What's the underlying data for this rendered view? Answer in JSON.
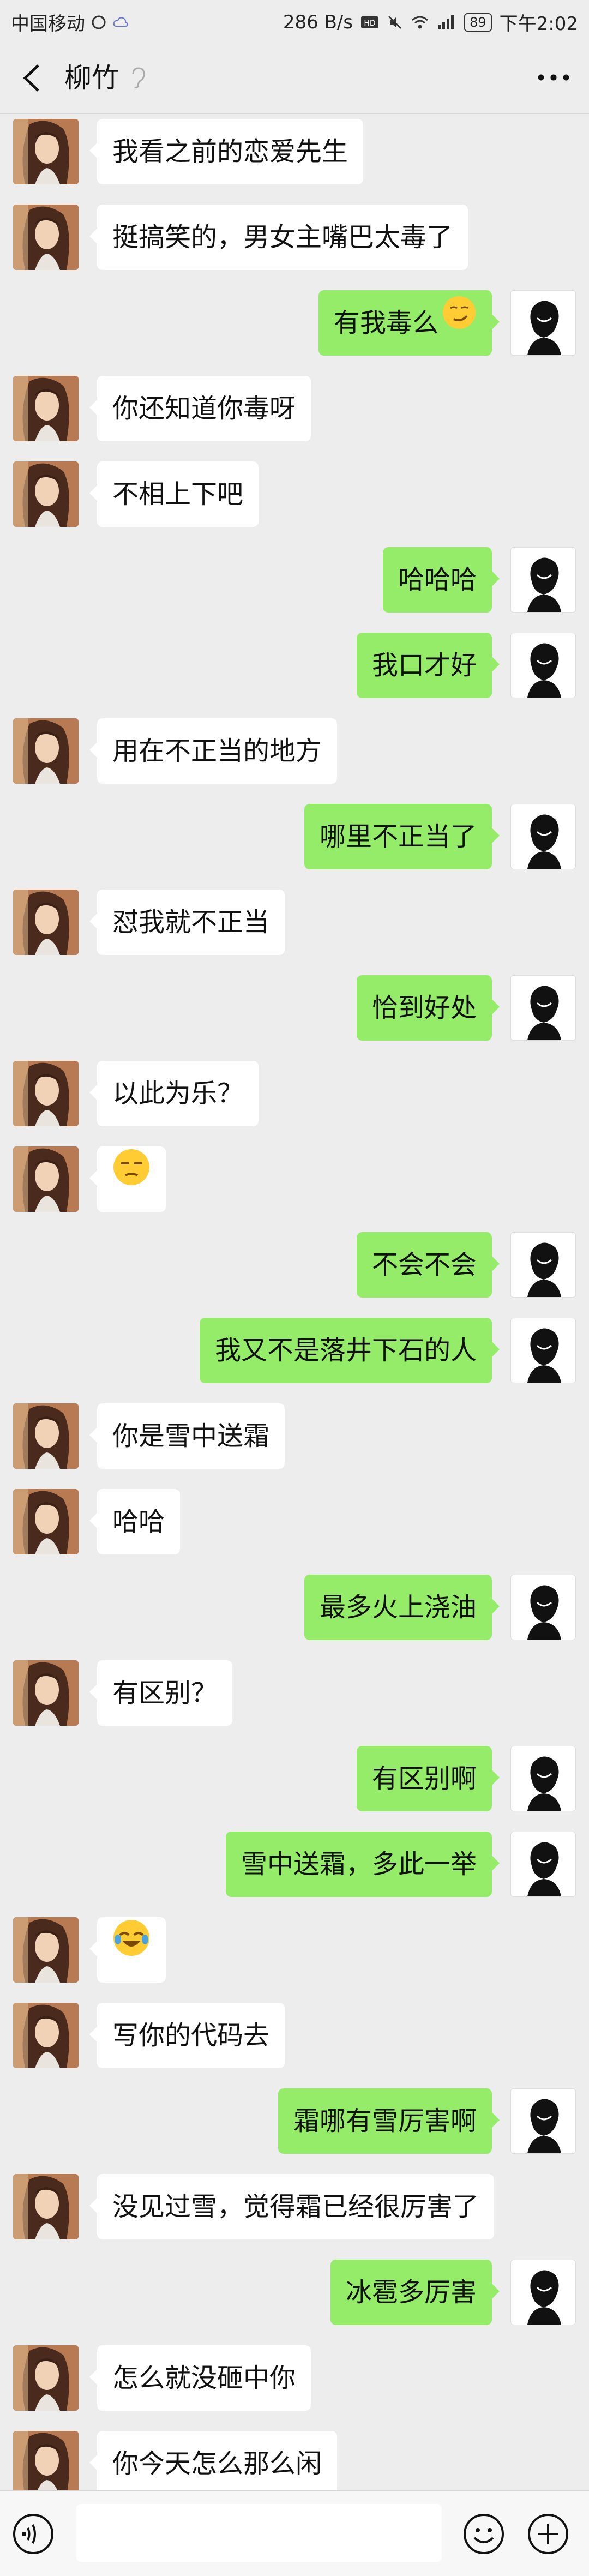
{
  "status_bar": {
    "carrier": "中国移动",
    "speed": "286 B/s",
    "battery": "89",
    "time": "下午2:02"
  },
  "header": {
    "contact_name": "柳竹"
  },
  "input": {
    "placeholder": ""
  },
  "messages": [
    {
      "from": "her",
      "text": "我看之前的恋爱先生"
    },
    {
      "from": "her",
      "text": "挺搞笑的，男女主嘴巴太毒了"
    },
    {
      "from": "me",
      "text": "有我毒么",
      "emoji": "smirk-emoji"
    },
    {
      "from": "her",
      "text": "你还知道你毒呀"
    },
    {
      "from": "her",
      "text": "不相上下吧"
    },
    {
      "from": "me",
      "text": "哈哈哈"
    },
    {
      "from": "me",
      "text": "我口才好"
    },
    {
      "from": "her",
      "text": "用在不正当的地方"
    },
    {
      "from": "me",
      "text": "哪里不正当了"
    },
    {
      "from": "her",
      "text": "怼我就不正当"
    },
    {
      "from": "me",
      "text": "恰到好处"
    },
    {
      "from": "her",
      "text": "以此为乐？"
    },
    {
      "from": "her",
      "text": "",
      "emoji": "unamused-emoji"
    },
    {
      "from": "me",
      "text": "不会不会"
    },
    {
      "from": "me",
      "text": "我又不是落井下石的人"
    },
    {
      "from": "her",
      "text": "你是雪中送霜"
    },
    {
      "from": "her",
      "text": "哈哈"
    },
    {
      "from": "me",
      "text": "最多火上浇油"
    },
    {
      "from": "her",
      "text": "有区别？"
    },
    {
      "from": "me",
      "text": "有区别啊"
    },
    {
      "from": "me",
      "text": "雪中送霜，多此一举"
    },
    {
      "from": "her",
      "text": "",
      "emoji": "laughing-crying-emoji"
    },
    {
      "from": "her",
      "text": "写你的代码去"
    },
    {
      "from": "me",
      "text": "霜哪有雪厉害啊"
    },
    {
      "from": "her",
      "text": "没见过雪，觉得霜已经很厉害了"
    },
    {
      "from": "me",
      "text": "冰雹多厉害"
    },
    {
      "from": "her",
      "text": "怎么就没砸中你"
    },
    {
      "from": "her",
      "text": "你今天怎么那么闲"
    }
  ]
}
